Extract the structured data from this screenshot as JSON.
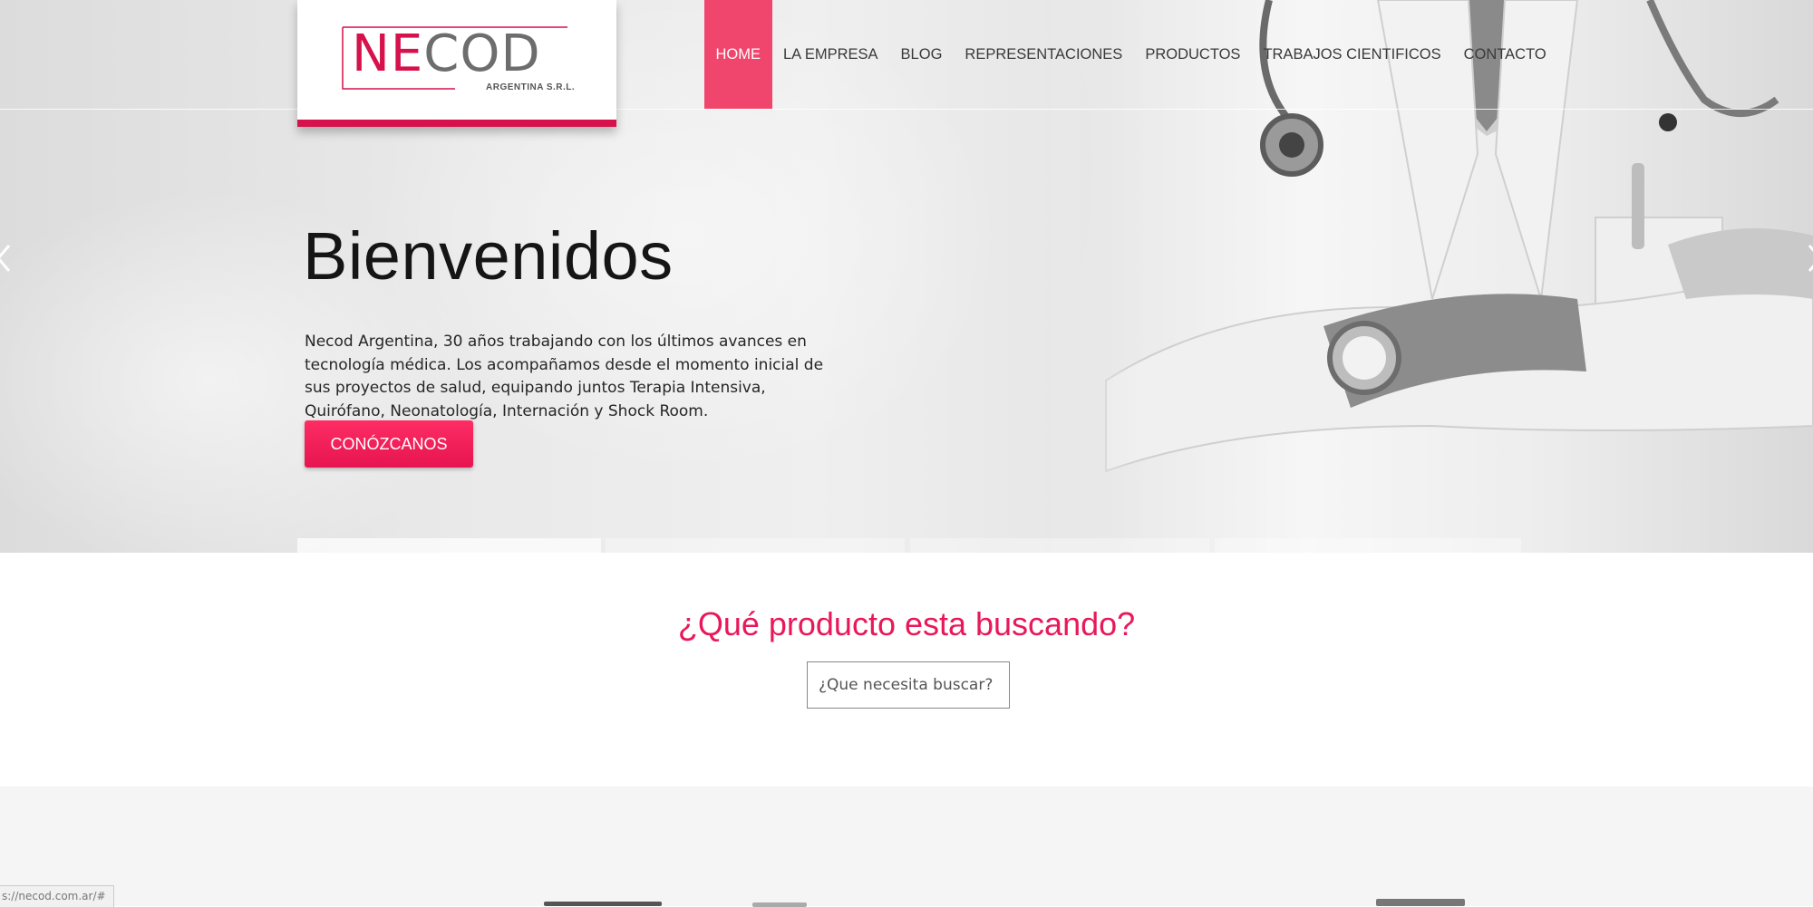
{
  "brand": {
    "logo_ne": "NE",
    "logo_cod": "COD",
    "logo_sub": "ARGENTINA S.R.L.",
    "accent_color": "#d6114b"
  },
  "nav": {
    "items": [
      {
        "label": "HOME",
        "active": true
      },
      {
        "label": "LA EMPRESA",
        "active": false
      },
      {
        "label": "BLOG",
        "active": false
      },
      {
        "label": "REPRESENTACIONES",
        "active": false
      },
      {
        "label": "PRODUCTOS",
        "active": false
      },
      {
        "label": "TRABAJOS CIENTIFICOS",
        "active": false
      },
      {
        "label": "CONTACTO",
        "active": false
      }
    ]
  },
  "hero": {
    "title": "Bienvenidos",
    "text": "Necod Argentina, 30 años trabajando con los últimos avances en tecnología médica. Los acompañamos desde el momento inicial de sus proyectos de salud, equipando juntos Terapia Intensiva, Quirófano, Neonatología, Internación y Shock Room.",
    "button_label": "CONÓZCANOS",
    "button_color": "#f0245a"
  },
  "search": {
    "title": "¿Qué producto esta buscando?",
    "placeholder": "¿Que necesita buscar?",
    "value": ""
  },
  "status_bar": {
    "url": "s://necod.com.ar/#"
  },
  "icons": {
    "slider_prev": "chevron-left-icon",
    "slider_next": "chevron-right-icon"
  }
}
